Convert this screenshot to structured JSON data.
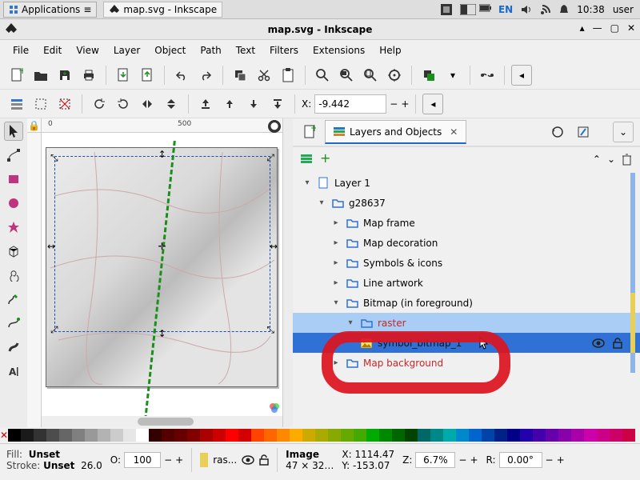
{
  "system": {
    "applications_label": "Applications",
    "task_title": "map.svg - Inkscape",
    "lang": "EN",
    "clock": "10:38",
    "user": "user"
  },
  "window": {
    "title": "map.svg - Inkscape"
  },
  "menus": [
    "File",
    "Edit",
    "View",
    "Layer",
    "Object",
    "Path",
    "Text",
    "Filters",
    "Extensions",
    "Help"
  ],
  "toolbar2": {
    "x_label": "X:",
    "x_value": "-9.442"
  },
  "ruler": {
    "t0": "0",
    "t500": "500"
  },
  "panel": {
    "tab_label": "Layers and Objects",
    "tree": {
      "layer1": "Layer 1",
      "g": "g28637",
      "frame": "Map frame",
      "deco": "Map decoration",
      "sym": "Symbols & icons",
      "line": "Line artwork",
      "bitmap": "Bitmap (in foreground)",
      "raster": "raster",
      "symbit": "symbol_bitmap_1",
      "bg": "Map background"
    }
  },
  "status": {
    "fill_label": "Fill:",
    "stroke_label": "Stroke:",
    "fill_value": "Unset",
    "stroke_value": "Unset",
    "stroke_w": "26.0",
    "o_label": "O:",
    "opacity": "100",
    "layer_short": "ras...",
    "obj_type": "Image",
    "obj_dims": "47 × 32…",
    "x_label": "X:",
    "y_label": "Y:",
    "x": "1114.47",
    "y": "-153.07",
    "z_label": "Z:",
    "zoom": "6.7%",
    "r_label": "R:",
    "rot": "0.00°"
  },
  "palette_colors": [
    "#000000",
    "#1a1a1a",
    "#333333",
    "#4d4d4d",
    "#666666",
    "#808080",
    "#999999",
    "#b3b3b3",
    "#cccccc",
    "#e6e6e6",
    "#ffffff",
    "#330000",
    "#550000",
    "#660000",
    "#800000",
    "#aa0000",
    "#cc0000",
    "#ff0000",
    "#d40000",
    "#ff4400",
    "#ff6600",
    "#ff8800",
    "#ffaa00",
    "#ccaa00",
    "#aaaa00",
    "#88aa00",
    "#66aa00",
    "#44aa00",
    "#00aa00",
    "#008800",
    "#006600",
    "#004400",
    "#006666",
    "#008888",
    "#00aaaa",
    "#0088cc",
    "#0066cc",
    "#0044aa",
    "#002288",
    "#000088",
    "#2200aa",
    "#4400aa",
    "#6600aa",
    "#8800aa",
    "#aa00aa",
    "#cc00aa",
    "#cc0088",
    "#cc0066",
    "#cc0044"
  ]
}
